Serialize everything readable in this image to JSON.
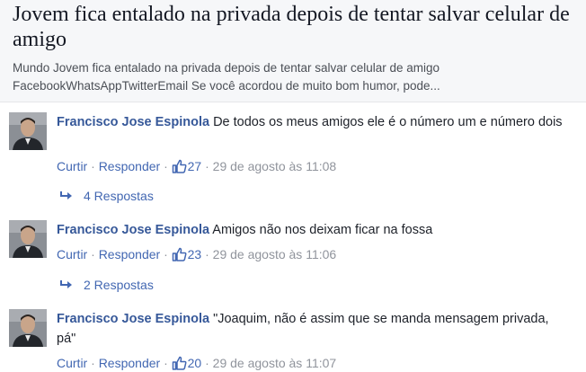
{
  "link_card": {
    "title": "Jovem fica entalado na privada depois de tentar salvar celular de amigo",
    "desc_line1": "Mundo Jovem fica entalado na privada depois de tentar salvar celular de amigo",
    "desc_line2": "FacebookWhatsAppTwitterEmail Se você acordou de muito bom humor, pode..."
  },
  "comments": [
    {
      "author": "Francisco Jose Espinola",
      "text": "De todos os meus amigos ele é o número um e número dois",
      "like_label": "Curtir",
      "reply_label": "Responder",
      "likes": "27",
      "timestamp": "29 de agosto às 11:08",
      "replies_label": "4 Respostas"
    },
    {
      "author": "Francisco Jose Espinola",
      "text": "Amigos não nos deixam ficar na fossa",
      "like_label": "Curtir",
      "reply_label": "Responder",
      "likes": "23",
      "timestamp": "29 de agosto às 11:06",
      "replies_label": "2 Respostas"
    },
    {
      "author": "Francisco Jose Espinola",
      "text": "\"Joaquim, não é assim que se manda mensagem privada, pá\"",
      "like_label": "Curtir",
      "reply_label": "Responder",
      "likes": "20",
      "timestamp": "29 de agosto às 11:07"
    }
  ],
  "separator": "·",
  "icons": {
    "like": "thumbs-up-icon",
    "reply_arrow": "reply-arrow-icon",
    "avatar": "profile-photo"
  },
  "colors": {
    "link": "#4267b2",
    "author": "#365899",
    "meta": "#90949c",
    "card_bg": "#f6f7f9"
  }
}
